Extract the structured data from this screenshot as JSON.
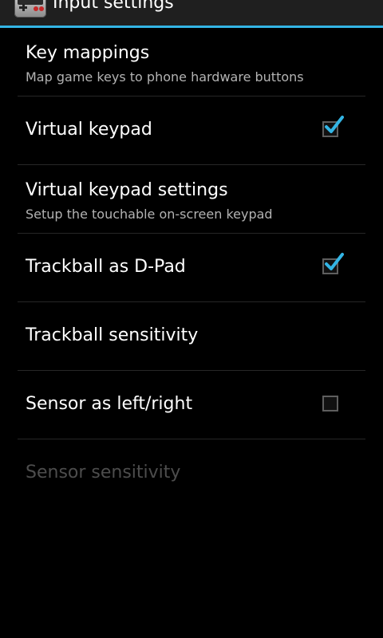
{
  "action_bar": {
    "title": "Input settings",
    "icon": "nes-controller-app-icon"
  },
  "colors": {
    "accent": "#33b5e5",
    "background": "#000000",
    "summary_text": "#b3b3b3",
    "disabled_text": "#4d4d4d"
  },
  "preferences": {
    "key_mappings": {
      "title": "Key mappings",
      "summary": "Map game keys to phone hardware buttons"
    },
    "virtual_keypad": {
      "title": "Virtual keypad",
      "checked": true
    },
    "virtual_keypad_settings": {
      "title": "Virtual keypad settings",
      "summary": "Setup the touchable on-screen keypad"
    },
    "trackball_dpad": {
      "title": "Trackball as D-Pad",
      "checked": true
    },
    "trackball_sensitivity": {
      "title": "Trackball sensitivity"
    },
    "sensor_left_right": {
      "title": "Sensor as left/right",
      "checked": false
    },
    "sensor_sensitivity": {
      "title": "Sensor sensitivity",
      "enabled": false
    }
  }
}
